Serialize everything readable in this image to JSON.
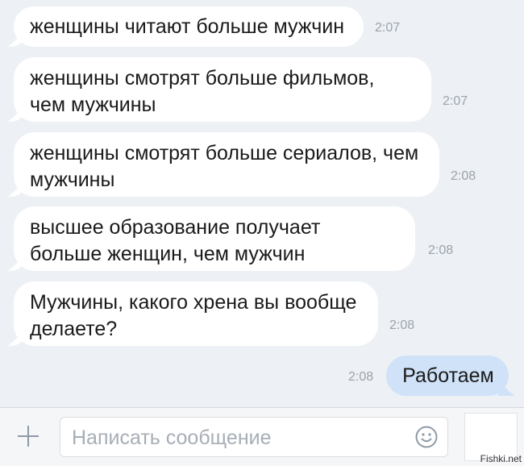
{
  "messages": [
    {
      "text": "женщины читают больше мужчин",
      "time": "2:07"
    },
    {
      "text": "женщины смотрят больше фильмов, чем мужчины",
      "time": "2:07"
    },
    {
      "text": "женщины смотрят больше сериалов, чем мужчины",
      "time": "2:08"
    },
    {
      "text": "высшее образование получает больше женщин, чем мужчин",
      "time": "2:08"
    },
    {
      "text": "Мужчины, какого хрена вы вообще делаете?",
      "time": "2:08"
    },
    {
      "text": "Работаем",
      "time": "2:08"
    }
  ],
  "composer": {
    "placeholder": "Написать сообщение"
  },
  "watermark": "Fishki.net",
  "colors": {
    "chat_bg": "#edf0f4",
    "incoming_bubble": "#ffffff",
    "outgoing_bubble": "#cfe2f7",
    "time_text": "#9aa3ad"
  }
}
